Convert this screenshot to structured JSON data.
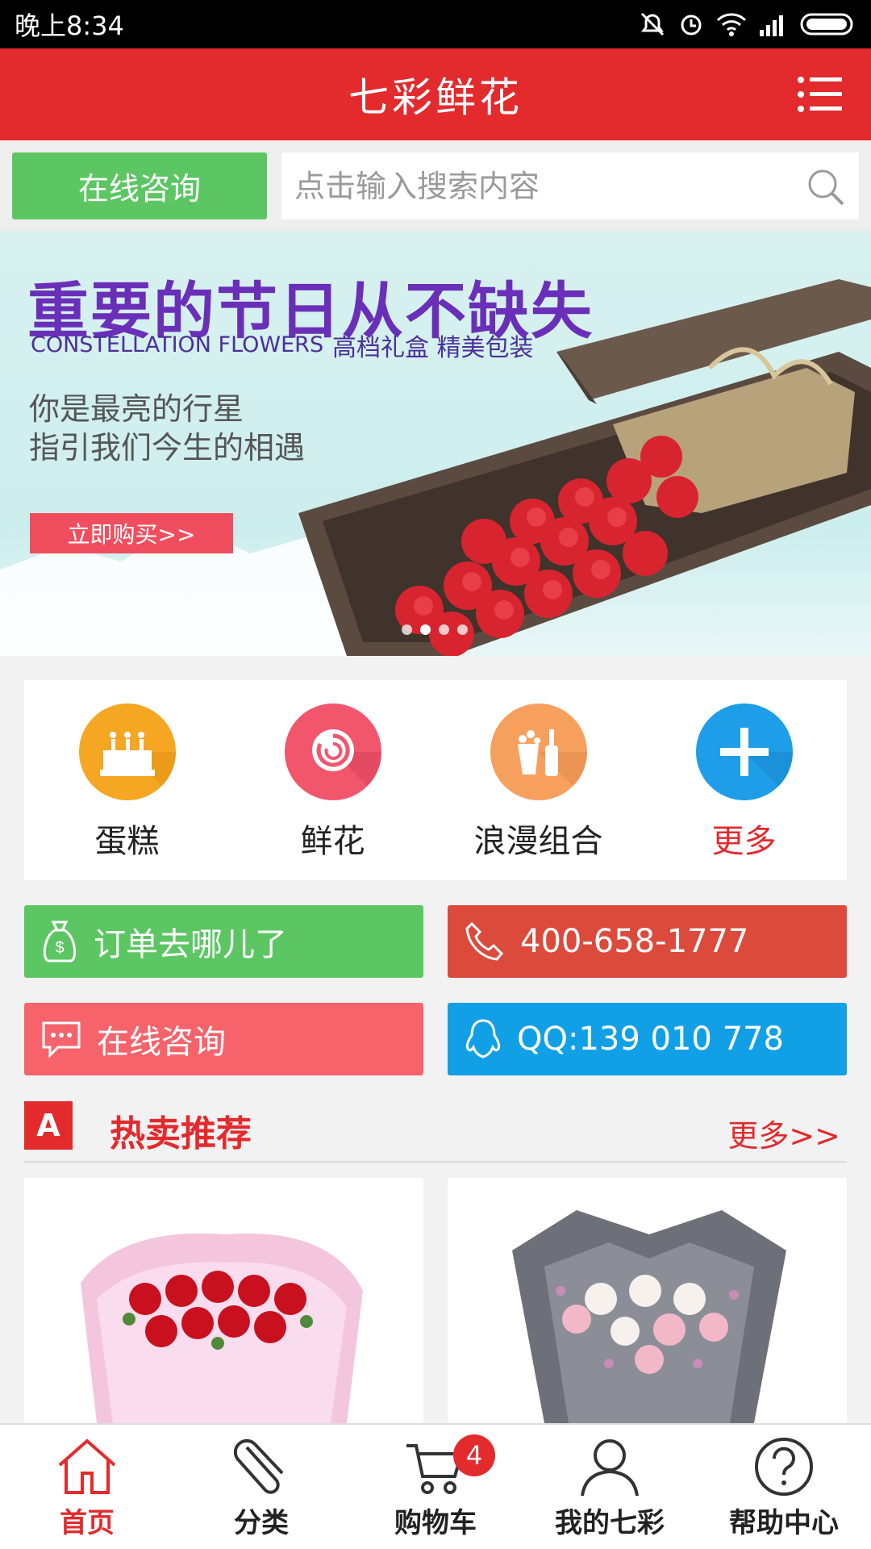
{
  "status_bar": {
    "time": "晚上8:34",
    "icons": [
      "mute-icon",
      "alarm-icon",
      "wifi-icon",
      "signal-icon",
      "battery-icon"
    ]
  },
  "header": {
    "title": "七彩鲜花",
    "menu_icon": "list-menu-icon"
  },
  "search_row": {
    "consult_label": "在线咨询",
    "search_placeholder": "点击输入搜索内容",
    "search_icon": "search-icon"
  },
  "banner": {
    "headline": "重要的节日从不缺失",
    "english_line": "CONSTELLATION FLOWERS",
    "tagline": "高档礼盒 精美包装",
    "poem_line1": "你是最亮的行星",
    "poem_line2": "指引我们今生的相遇",
    "buy_label": "立即购买>>",
    "slide_count": 4,
    "active_slide": 2
  },
  "categories": [
    {
      "label": "蛋糕",
      "icon": "cake-icon",
      "color": "#f5a623"
    },
    {
      "label": "鲜花",
      "icon": "rose-icon",
      "color": "#f2566d"
    },
    {
      "label": "浪漫组合",
      "icon": "gift-combo-icon",
      "color": "#f7a05e"
    },
    {
      "label": "更多",
      "icon": "plus-icon",
      "color": "#1e9ee8"
    }
  ],
  "actions": {
    "order_label": "订单去哪儿了",
    "phone_label": "400-658-1777",
    "consult_label": "在线咨询",
    "qq_label": "QQ:139 010 778"
  },
  "section": {
    "badge": "A",
    "title": "热卖推荐",
    "more": "更多>>"
  },
  "products": [
    {
      "image": "red-rose-bouquet-image"
    },
    {
      "image": "pink-white-rose-bouquet-image"
    }
  ],
  "tabbar": {
    "items": [
      {
        "label": "首页",
        "icon": "home-icon",
        "active": true
      },
      {
        "label": "分类",
        "icon": "paperclip-icon",
        "active": false
      },
      {
        "label": "购物车",
        "icon": "cart-icon",
        "active": false,
        "badge": "4"
      },
      {
        "label": "我的七彩",
        "icon": "user-icon",
        "active": false
      },
      {
        "label": "帮助中心",
        "icon": "help-icon",
        "active": false
      }
    ]
  },
  "colors": {
    "brand_red": "#e32a2d",
    "green": "#5cc663",
    "blue": "#11a0e6"
  }
}
